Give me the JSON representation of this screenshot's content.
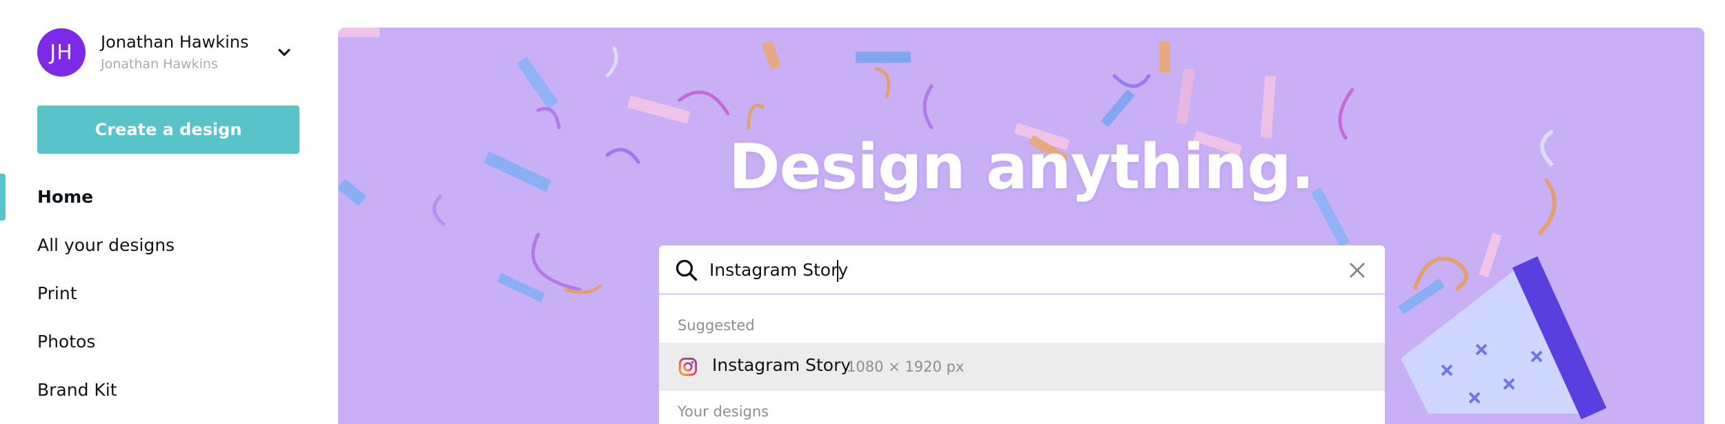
{
  "account": {
    "initials": "JH",
    "name": "Jonathan Hawkins",
    "team": "Jonathan Hawkins",
    "avatar_color": "#7d2ae8"
  },
  "sidebar": {
    "create_label": "Create a design",
    "accent_color": "#58c3c9",
    "items": [
      {
        "label": "Home",
        "active": true
      },
      {
        "label": "All your designs",
        "active": false
      },
      {
        "label": "Print",
        "active": false
      },
      {
        "label": "Photos",
        "active": false
      },
      {
        "label": "Brand Kit",
        "active": false
      }
    ]
  },
  "hero": {
    "title": "Design anything.",
    "background_color": "#c8aff6"
  },
  "search": {
    "value": "Instagram Story",
    "icon": "search-icon",
    "clear_icon": "close-icon"
  },
  "dropdown": {
    "suggested_label": "Suggested",
    "suggestion": {
      "title": "Instagram Story",
      "dimensions": "1080 × 1920 px",
      "icon": "instagram-icon"
    },
    "your_designs_label": "Your designs"
  }
}
